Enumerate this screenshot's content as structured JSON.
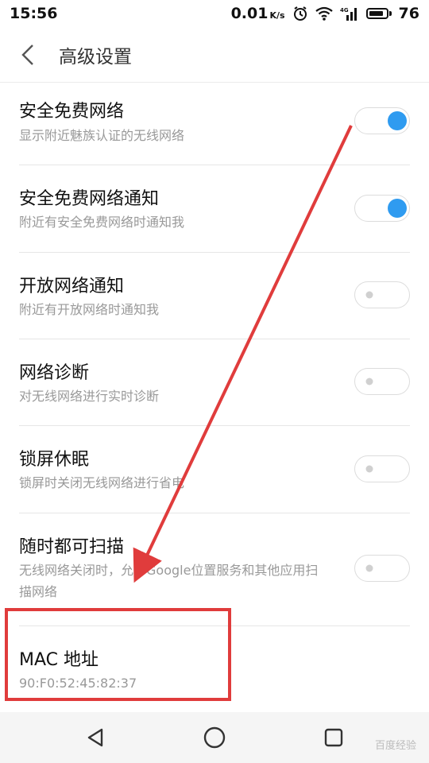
{
  "status_bar": {
    "time": "15:56",
    "network_speed": "0.01",
    "speed_unit": "K/s",
    "signal_label": "4G",
    "battery": "76"
  },
  "header": {
    "title": "高级设置",
    "back_icon": "chevron-left-icon"
  },
  "settings": [
    {
      "title": "安全免费网络",
      "description": "显示附近魅族认证的无线网络",
      "enabled": true
    },
    {
      "title": "安全免费网络通知",
      "description": "附近有安全免费网络时通知我",
      "enabled": true
    },
    {
      "title": "开放网络通知",
      "description": "附近有开放网络时通知我",
      "enabled": false
    },
    {
      "title": "网络诊断",
      "description": "对无线网络进行实时诊断",
      "enabled": false
    },
    {
      "title": "锁屏休眠",
      "description": "锁屏时关闭无线网络进行省电",
      "enabled": false
    },
    {
      "title": "随时都可扫描",
      "description": "无线网络关闭时，允许Google位置服务和其他应用扫描网络",
      "enabled": false
    }
  ],
  "mac": {
    "title": "MAC 地址",
    "value": "90:F0:52:45:82:37"
  },
  "nav": {
    "back_icon": "triangle-back-icon",
    "home_icon": "circle-home-icon",
    "recent_icon": "square-recent-icon"
  },
  "watermark": "百度经验",
  "colors": {
    "toggle_on": "#2f9bf0",
    "annotation_red": "#e03c3c",
    "description_text": "#999999"
  }
}
